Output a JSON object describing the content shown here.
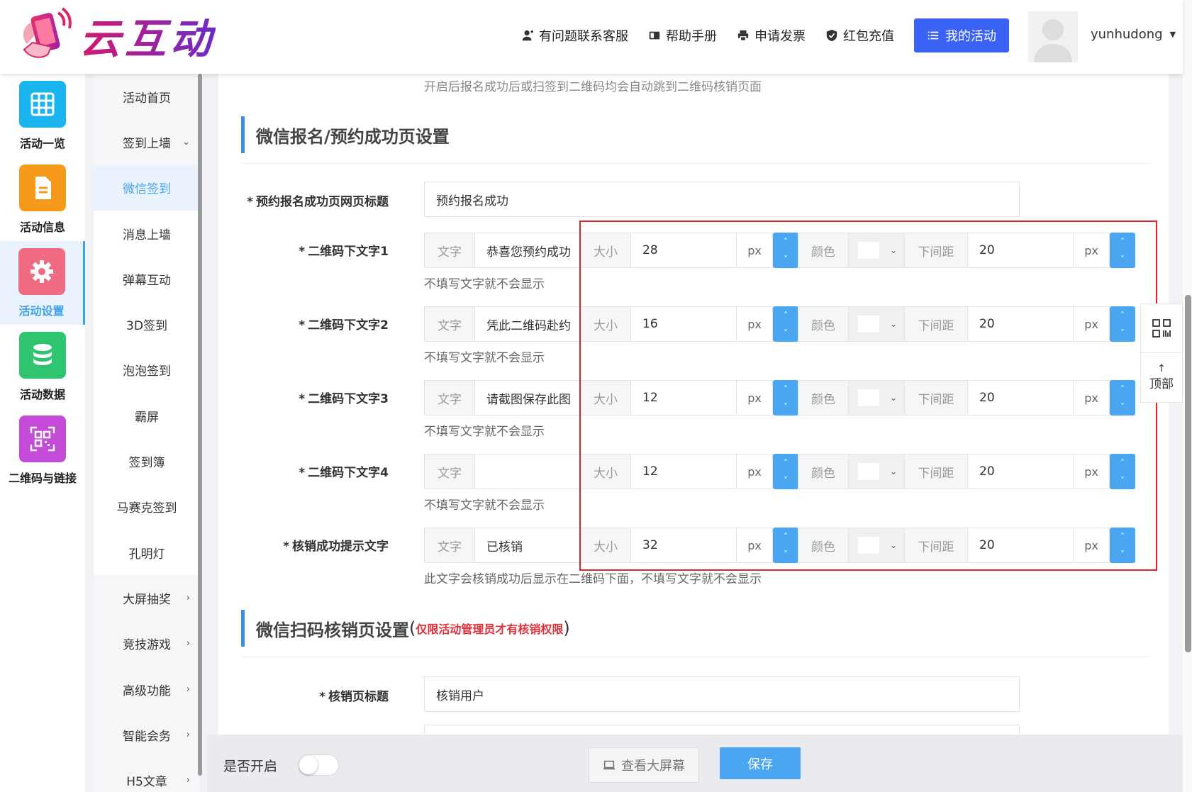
{
  "header": {
    "logo_text": "云互动",
    "nav": [
      "有问题联系客服",
      "帮助手册",
      "申请发票",
      "红包充值"
    ],
    "my_activity": "我的活动",
    "username": "yunhudong"
  },
  "nav1": [
    {
      "label": "活动一览",
      "icon": "grid-icon",
      "color": "#1ab5ef"
    },
    {
      "label": "活动信息",
      "icon": "document-icon",
      "color": "#f59a1b"
    },
    {
      "label": "活动设置",
      "icon": "gear-icon",
      "color": "#f06b82"
    },
    {
      "label": "活动数据",
      "icon": "database-icon",
      "color": "#2fc46f"
    },
    {
      "label": "二维码与链接",
      "icon": "qrcode-icon",
      "color": "#c44ad8"
    }
  ],
  "nav2": [
    "活动首页",
    "签到上墙",
    "微信签到",
    "消息上墙",
    "弹幕互动",
    "3D签到",
    "泡泡签到",
    "霸屏",
    "签到簿",
    "马赛克签到",
    "孔明灯",
    "大屏抽奖",
    "竞技游戏",
    "高级功能",
    "智能会务",
    "H5文章"
  ],
  "content": {
    "top_hint": "开启后报名成功后或扫签到二维码均会自动跳到二维码核销页面",
    "section1_title": "微信报名/预约成功页设置",
    "page_title_label": "预约报名成功页网页标题",
    "page_title_value": "预约报名成功",
    "addon_text": "文字",
    "addon_size": "大小",
    "addon_color": "颜色",
    "addon_spacing": "下间距",
    "unit": "px",
    "rows": [
      {
        "label": "二维码下文字1",
        "text": "恭喜您预约成功",
        "size": "28",
        "spacing": "20",
        "hint": "不填写文字就不会显示"
      },
      {
        "label": "二维码下文字2",
        "text": "凭此二维码赴约",
        "size": "16",
        "spacing": "20",
        "hint": "不填写文字就不会显示"
      },
      {
        "label": "二维码下文字3",
        "text": "请截图保存此图",
        "size": "12",
        "spacing": "20",
        "hint": "不填写文字就不会显示"
      },
      {
        "label": "二维码下文字4",
        "text": "",
        "size": "12",
        "spacing": "20",
        "hint": "不填写文字就不会显示"
      },
      {
        "label": "核销成功提示文字",
        "text": "已核销",
        "size": "32",
        "spacing": "20",
        "hint": "此文字会核销成功后显示在二维码下面，不填写文字就不会显示"
      }
    ],
    "section2_title": "微信扫码核销页设置",
    "section2_paren_open": "(",
    "section2_note": "仅限活动管理员才有核销权限",
    "section2_paren_close": ")",
    "verify_title_label": "核销页标题",
    "verify_title_value": "核销用户"
  },
  "side_tools": {
    "top_arrow": "↑",
    "top_label": "顶部"
  },
  "footer": {
    "open_label": "是否开启",
    "view_btn": "查看大屏幕",
    "save_btn": "保存"
  }
}
